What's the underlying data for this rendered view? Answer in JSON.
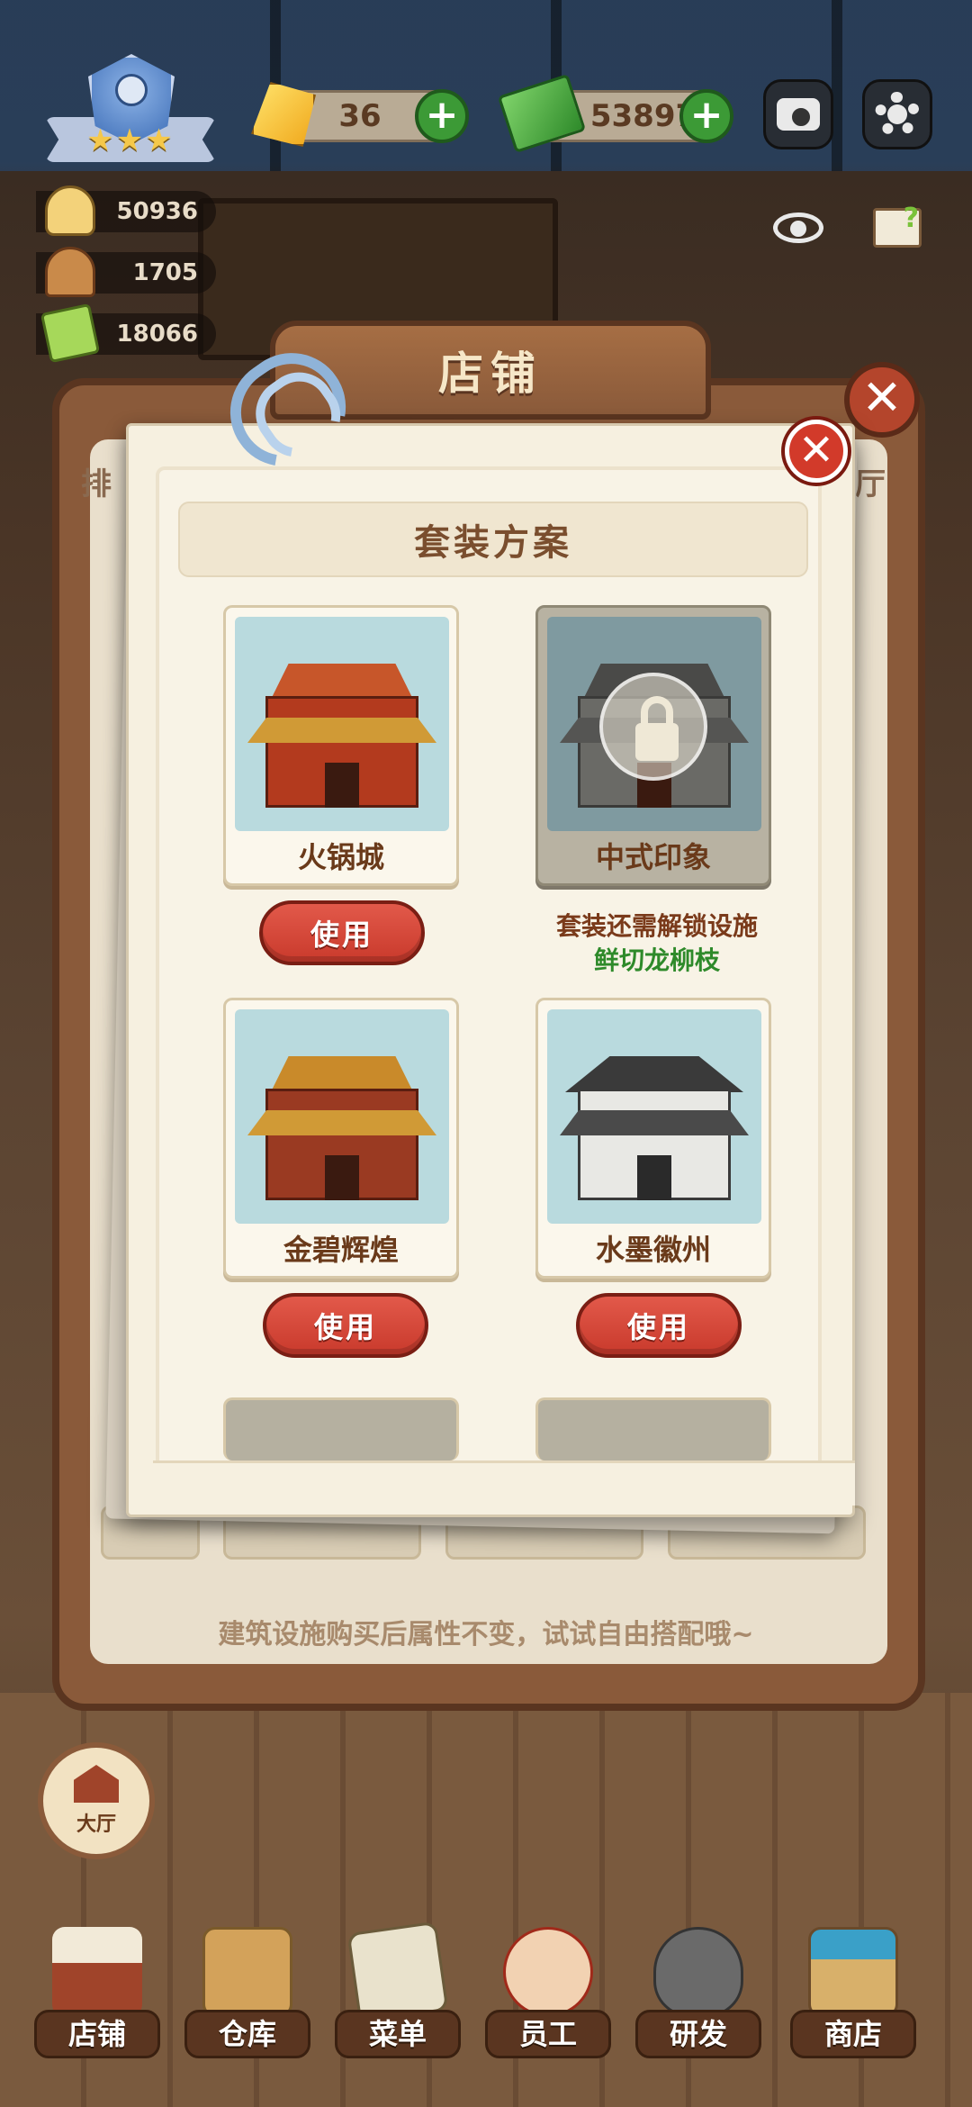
{
  "hud": {
    "stars": "★★★",
    "gems": "36",
    "cash": "53897",
    "plus": "+",
    "stats": [
      "50936",
      "1705",
      "18066"
    ]
  },
  "shop_panel": {
    "title": "店铺",
    "close": "✕",
    "tab_left": "排",
    "tab_right": "厅",
    "footer": "建筑设施购买后属性不变，试试自由搭配哦~"
  },
  "scheme": {
    "title": "套装方案",
    "close": "✕",
    "cards": [
      {
        "name": "火锅城",
        "locked": false,
        "action": "使用"
      },
      {
        "name": "中式印象",
        "locked": true,
        "hint_line1": "套装还需解锁设施",
        "hint_line2": "鲜切龙柳枝"
      },
      {
        "name": "金碧辉煌",
        "locked": false,
        "action": "使用"
      },
      {
        "name": "水墨徽州",
        "locked": false,
        "action": "使用"
      }
    ]
  },
  "hall_button": "大厅",
  "nav": [
    "店铺",
    "仓库",
    "菜单",
    "员工",
    "研发",
    "商店"
  ],
  "colors": {
    "accent_red": "#d23a2a",
    "use_button": "#e2594a",
    "hint_green": "#2e8a2a",
    "panel_brown": "#8a5a3a"
  }
}
